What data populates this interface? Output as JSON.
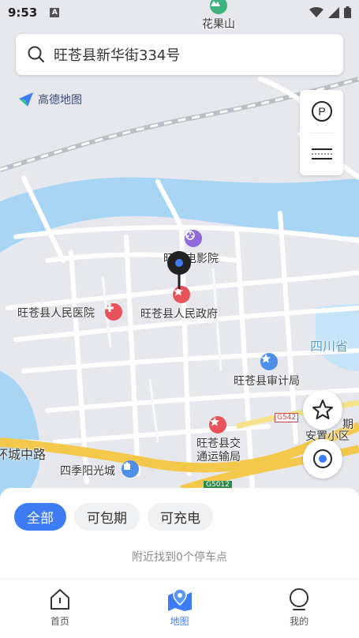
{
  "status_bar": {
    "time": "9:53",
    "badge": "A"
  },
  "search": {
    "value": "旺苍县新华街334号"
  },
  "logo": {
    "text": "高德地图"
  },
  "map": {
    "labels": {
      "huaguoshan": "花果山",
      "cinema": "旺苍电影院",
      "hospital": "旺苍县人民医院",
      "gov": "旺苍县人民政府",
      "audit": "旺苍县审计局",
      "sichuan": "四川省",
      "transport_line1": "旺苍县交",
      "transport_line2": "通运输局",
      "anju_line1": "安置小区",
      "chengzhong": "环城中路",
      "siji": "四季阳光城",
      "g542": "G542",
      "g5012": "G5012",
      "qi": "期"
    }
  },
  "filters": {
    "chips": [
      {
        "label": "全部",
        "active": true
      },
      {
        "label": "可包期",
        "active": false
      },
      {
        "label": "可充电",
        "active": false
      }
    ],
    "hint": "附近找到0个停车点"
  },
  "tabs": [
    {
      "label": "首页",
      "icon": "home-icon",
      "active": false
    },
    {
      "label": "地图",
      "icon": "map-icon",
      "active": true
    },
    {
      "label": "我的",
      "icon": "profile-icon",
      "active": false
    }
  ],
  "colors": {
    "accent": "#3d7cf4",
    "water": "#a9d5f5",
    "poi_red": "#e8525a",
    "poi_blue": "#4e8de8",
    "poi_purple": "#8e6bd8"
  }
}
